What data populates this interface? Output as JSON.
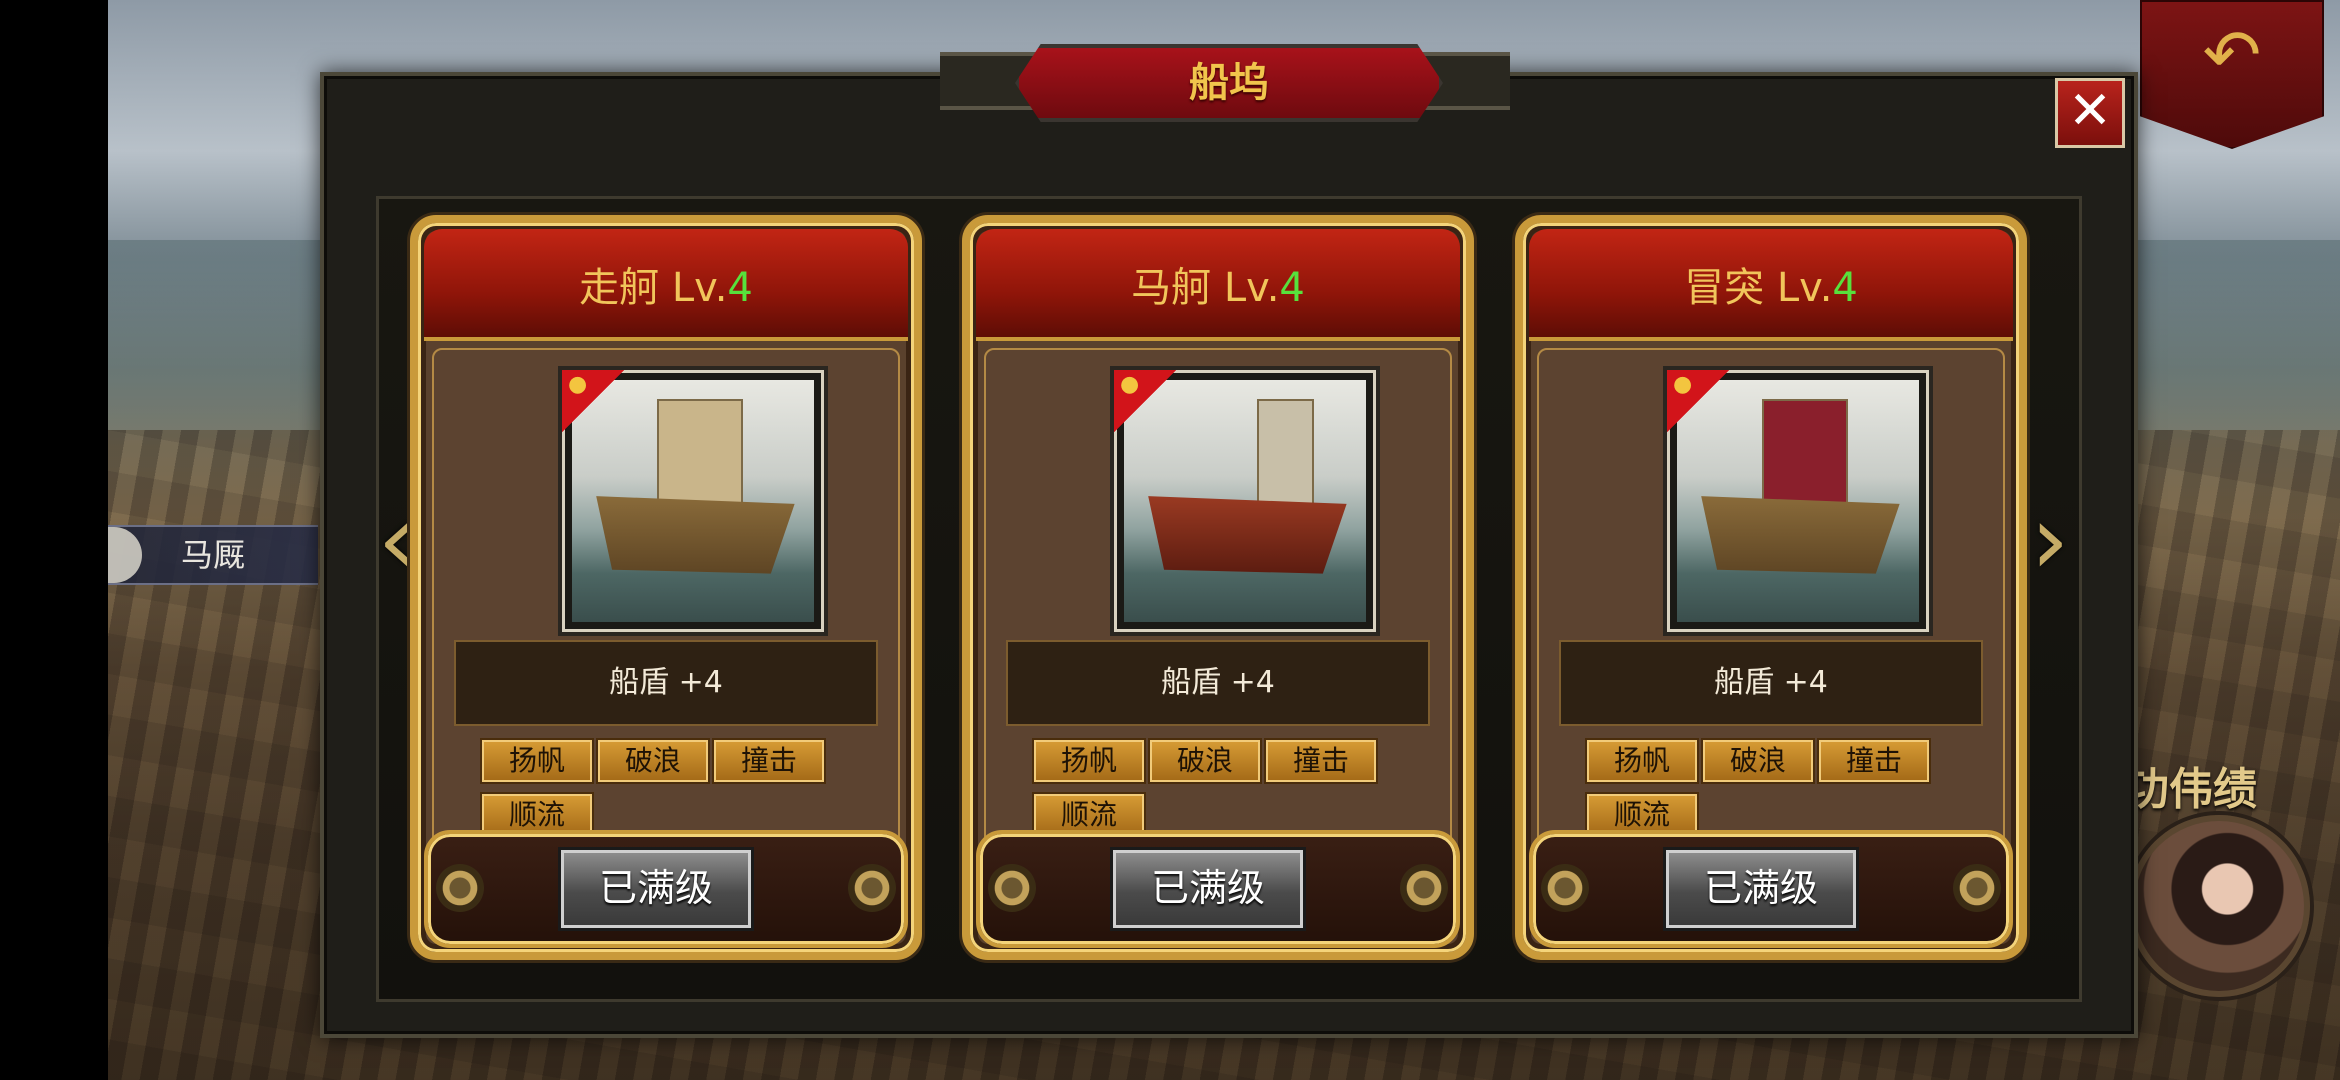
{
  "background": {
    "location_label": "马厩",
    "achievement_label": "功伟绩"
  },
  "dialog": {
    "title": "船坞",
    "close_symbol": "✕",
    "nav_left_symbol": "‹",
    "nav_right_symbol": "›"
  },
  "return_icon": "↶",
  "ships": [
    {
      "name": "走舸",
      "level_prefix": "Lv.",
      "level": "4",
      "stat": "船盾 +4",
      "skills": [
        "扬帆",
        "破浪",
        "撞击",
        "顺流"
      ],
      "button": "已满级"
    },
    {
      "name": "马舸",
      "level_prefix": "Lv.",
      "level": "4",
      "stat": "船盾 +4",
      "skills": [
        "扬帆",
        "破浪",
        "撞击",
        "顺流"
      ],
      "button": "已满级"
    },
    {
      "name": "冒突",
      "level_prefix": "Lv.",
      "level": "4",
      "stat": "船盾 +4",
      "skills": [
        "扬帆",
        "破浪",
        "撞击",
        "顺流"
      ],
      "button": "已满级"
    }
  ],
  "colors": {
    "title_gold": "#f1c54c",
    "level_green": "#57e13c",
    "header_red": "#c22514",
    "frame_gold": "#c99a3a"
  }
}
